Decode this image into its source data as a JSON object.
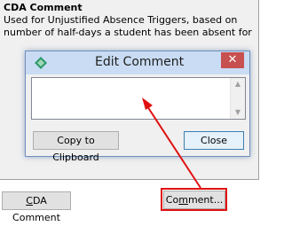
{
  "panel": {
    "title": "CDA Comment",
    "description": "Used for Unjustified Absence Triggers, based on number of half-days a student has been absent for"
  },
  "dialog": {
    "title": "Edit Comment",
    "close_glyph": "✕",
    "textarea_value": "",
    "copy_button": "Copy to Clipboard",
    "close_button": "Close"
  },
  "bottom": {
    "cda_button_underlined": "C",
    "cda_button_rest": "DA Comment",
    "comment_button_pre": "Co",
    "comment_button_underlined": "m",
    "comment_button_post": "ment..."
  },
  "colors": {
    "annotation": "#e01010",
    "titlebar": "#c9dcf3",
    "close_button_bg": "#c75050"
  }
}
